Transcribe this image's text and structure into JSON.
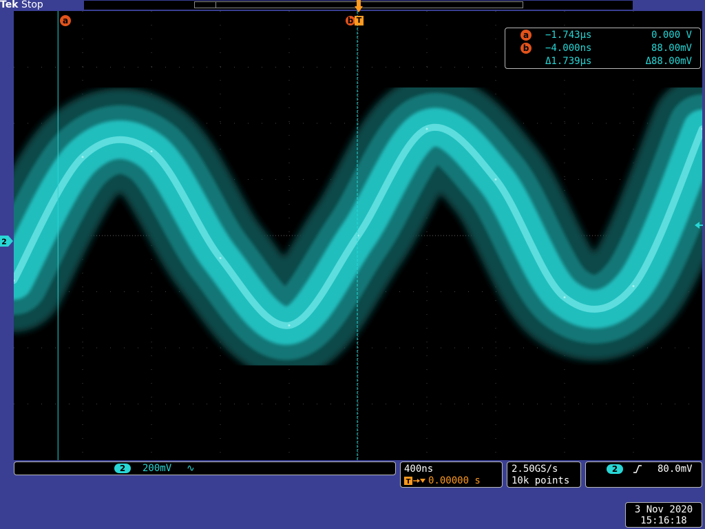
{
  "status": {
    "brand": "Tek",
    "state": "Stop"
  },
  "cursors": {
    "a_marker": "a",
    "b_marker": "b",
    "trigger_marker": "T",
    "a_time": "−1.743µs",
    "a_volt": "0.000 V",
    "b_time": "−4.000ns",
    "b_volt": "88.00mV",
    "delta_time": "Δ1.739µs",
    "delta_volt": "Δ88.00mV"
  },
  "channel": {
    "number": "2",
    "scale": "200mV",
    "coupling_icon": "∿"
  },
  "timebase": {
    "scale": "400ns",
    "trigger_position": "0.00000 s",
    "trigger_position_icon": "T→▾"
  },
  "acquisition": {
    "sample_rate": "2.50GS/s",
    "record_length": "10k points"
  },
  "trigger": {
    "source": "2",
    "slope_icon": "rising-edge",
    "slope_glyph": "ʃ",
    "level": "80.0mV"
  },
  "datetime": {
    "date": "3 Nov 2020",
    "time": "15:16:18"
  },
  "colors": {
    "background": "#3a3f94",
    "screen": "#000000",
    "trace": "#28d6d6",
    "cursor_marker": "#e2531b",
    "trigger_marker": "#ff9a1f"
  },
  "chart_data": {
    "type": "line",
    "x_unit": "s",
    "y_unit": "V",
    "xlim": [
      -2e-06,
      2e-06
    ],
    "ylim": [
      -0.8,
      0.8
    ],
    "grid": true,
    "series": [
      {
        "name": "2",
        "x": [
          -2e-06,
          -1.6e-06,
          -1.2e-06,
          -8e-07,
          -4e-07,
          0.0,
          4e-07,
          8e-07,
          1.2e-06,
          1.6e-06,
          2e-06
        ],
        "values": [
          -0.16,
          0.28,
          0.3,
          -0.08,
          -0.32,
          0.0,
          0.38,
          0.2,
          -0.22,
          -0.18,
          0.38
        ]
      }
    ]
  }
}
